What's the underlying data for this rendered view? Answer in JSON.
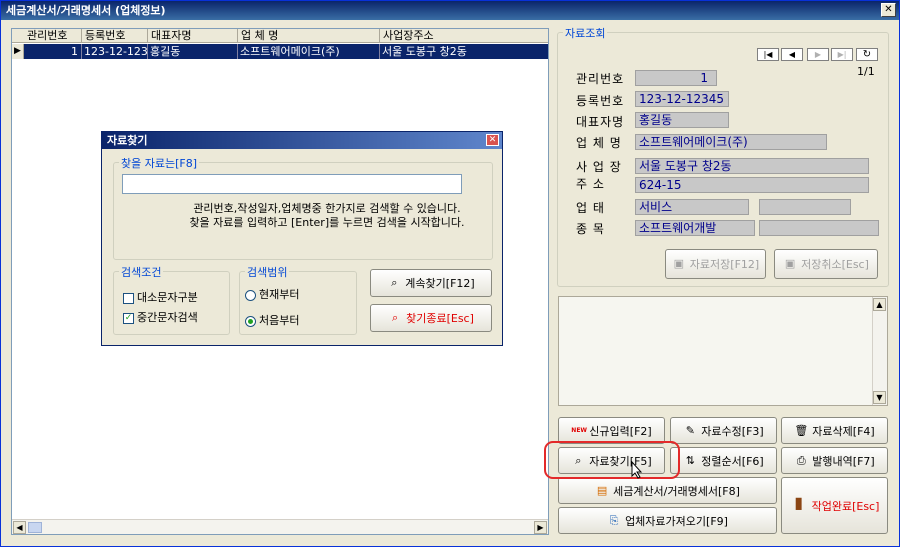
{
  "window": {
    "title": "세금계산서/거래명세서 (업체정보)",
    "close": "✕"
  },
  "grid": {
    "columns": [
      "관리번호",
      "등록번호",
      "대표자명",
      "업 체 명",
      "사업장주소"
    ],
    "rows": [
      [
        "1",
        "123-12-12345",
        "홍길동",
        "소프트웨어메이크(주)",
        "서울 도봉구 창2동"
      ]
    ],
    "indicator": "▶"
  },
  "lookup": {
    "title": "자료조회",
    "nav": {
      "first": "|◀",
      "prev": "◀",
      "next": "▶",
      "last": "▶|",
      "refresh": "↻",
      "page": "1/1"
    },
    "labels": {
      "mgmt_no": "관리번호",
      "reg_no": "등록번호",
      "ceo": "대표자명",
      "company": "업 체 명",
      "address_1": "사 업 장",
      "address_2": "주    소",
      "biz_type": "업    태",
      "biz_item": "종    목"
    },
    "values": {
      "mgmt_no": "1",
      "reg_no": "123-12-12345",
      "ceo": "홍길동",
      "company": "소프트웨어메이크(주)",
      "address_1": "서울 도봉구 창2동",
      "address_2": "624-15",
      "biz_type": "서비스",
      "biz_type_2": "",
      "biz_item": "소프트웨어개발",
      "biz_item_2": ""
    },
    "save_btn": "자료저장[F12]",
    "cancel_btn": "저장취소[Esc]"
  },
  "actions": {
    "new": "신규입력[F2]",
    "edit": "자료수정[F3]",
    "delete": "자료삭제[F4]",
    "find": "자료찾기[F5]",
    "sort": "정렬순서[F6]",
    "history": "발행내역[F7]",
    "invoice": "세금계산서/거래명세서[F8]",
    "import": "업체자료가져오기[F9]",
    "done": "작업완료[Esc]",
    "new_badge": "NEW"
  },
  "dialog": {
    "title": "자료찾기",
    "close": "✕",
    "group_find": "찾을 자료는[F8]",
    "input_value": "",
    "help_1": "관리번호,작성일자,업체명중 한가지로 검색할 수 있습니다.",
    "help_2": "찾을 자료를 입력하고 [Enter]를 누르면 검색을 시작합니다.",
    "group_cond": "검색조건",
    "opt_case": "대소문자구분",
    "opt_middle": "중간문자검색",
    "group_range": "검색범위",
    "opt_current": "현재부터",
    "opt_first": "처음부터",
    "btn_next": "계속찾기[F12]",
    "btn_close": "찾기종료[Esc]"
  }
}
